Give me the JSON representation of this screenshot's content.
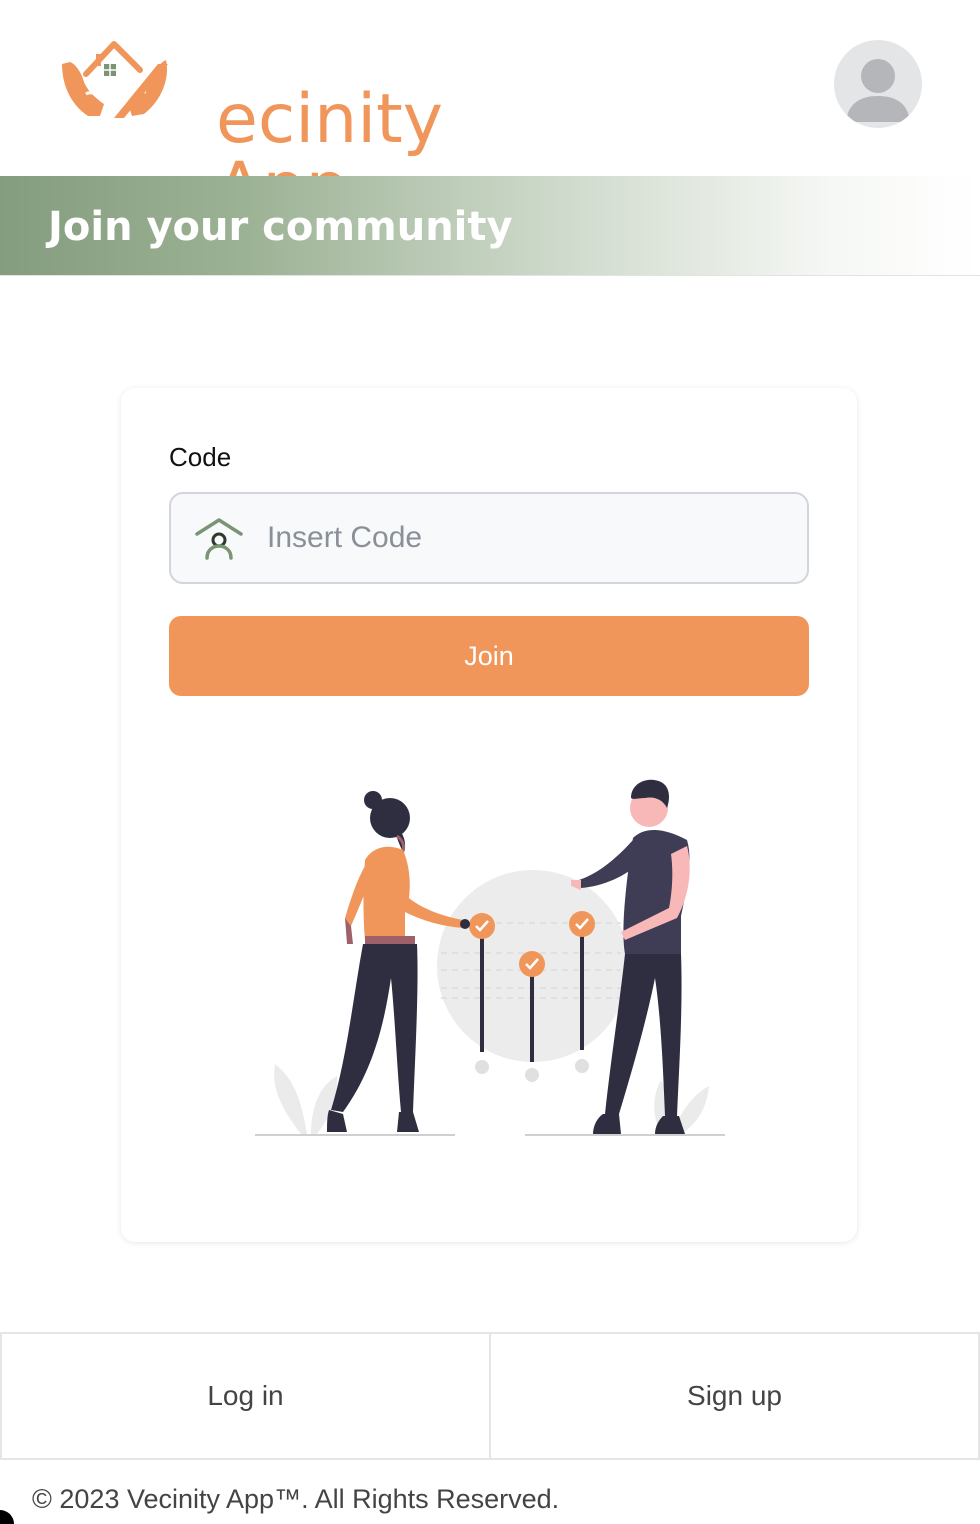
{
  "header": {
    "app_name": "Vecinity App",
    "logo_text": "ecinity App",
    "avatar_icon": "user-avatar-icon"
  },
  "banner": {
    "title": "Join your community"
  },
  "form": {
    "code_label": "Code",
    "code_placeholder": "Insert Code",
    "code_value": "",
    "code_icon": "home-person-icon",
    "join_label": "Join"
  },
  "illustration": {
    "name": "two-people-checklist-illustration"
  },
  "bottom_nav": {
    "login_label": "Log in",
    "signup_label": "Sign up"
  },
  "footer": {
    "copyright": "© 2023 Vecinity App™. All Rights Reserved."
  },
  "colors": {
    "accent_orange": "#f0965a",
    "accent_green": "#849d7e",
    "text_gray": "#444444"
  }
}
